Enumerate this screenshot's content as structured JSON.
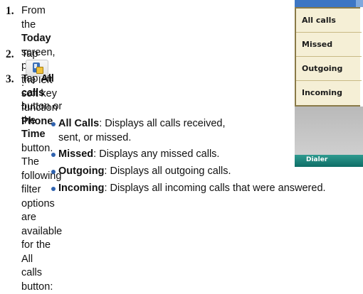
{
  "steps": [
    {
      "num": "1.",
      "a": "From the ",
      "b1": "Today",
      "c": " screen, press the left soft key",
      "d": "function ",
      "b2": "Phone",
      "e": "."
    },
    {
      "num": "2.",
      "a": "Tap",
      "e": "."
    },
    {
      "num": "3.",
      "a": "Tap ",
      "b1": "All calls",
      "c": " button or the ",
      "b2": "Time",
      "d": " button. The",
      "line2": "following filter options are available for the All",
      "line3": "calls button:"
    }
  ],
  "bullets": [
    {
      "term": "All Calls",
      "desc1": ": Displays all calls received,",
      "desc2": "sent, or missed."
    },
    {
      "term": "Missed",
      "desc1": ": Displays any missed calls."
    },
    {
      "term": "Outgoing",
      "desc1": ": Displays all outgoing calls."
    },
    {
      "term": "Incoming",
      "desc1": ": Displays all incoming calls that were answered."
    }
  ],
  "device": {
    "menu": [
      "All calls",
      "Missed",
      "Outgoing",
      "Incoming"
    ],
    "soft_key_left": "Dialer"
  }
}
